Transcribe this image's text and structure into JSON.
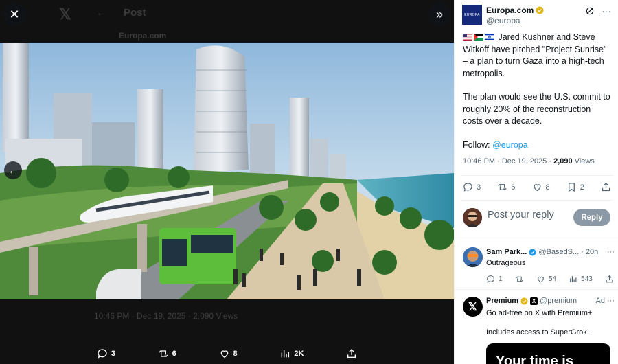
{
  "background": {
    "back_label": "Post",
    "author": "Europa.com",
    "timestamp": "10:46 PM · Dec 19, 2025 · 2,090 Views"
  },
  "overlay": {
    "bottom_bar": {
      "replies": "3",
      "reposts": "6",
      "likes": "8",
      "views": "2K"
    }
  },
  "post": {
    "author_name": "Europa.com",
    "author_handle": "@europa",
    "avatar_text": "EUROPA",
    "paragraph1": "Jared Kushner and Steve Witkoff have pitched \"Project Sunrise\" – a plan to turn Gaza into a high-tech metropolis.",
    "paragraph2": "The plan would see the U.S. commit to roughly 20% of the reconstruction costs over a decade.",
    "follow_label": "Follow: ",
    "follow_handle": "@europa",
    "time": "10:46 PM · Dec 19, 2025 · ",
    "views_count": "2,090",
    "views_label": " Views",
    "replies": "3",
    "reposts": "6",
    "likes": "8",
    "bookmarks": "2"
  },
  "reply_box": {
    "placeholder": "Post your reply",
    "button": "Reply"
  },
  "comment": {
    "name": "Sam Park...",
    "handle": "@BasedS...",
    "age": "· 20h",
    "text": "Outrageous",
    "replies": "1",
    "likes": "54",
    "views": "543"
  },
  "ad": {
    "name": "Premium",
    "handle": "@premium",
    "badge": "Ad",
    "line1": "Go ad-free on X with Premium+",
    "line2": "Includes access to SuperGrok.",
    "card_text": "Your time is"
  },
  "colors": {
    "accent": "#1d9bf0",
    "verified_gold": "#e2b719",
    "verified_blue": "#1d9bf0"
  }
}
